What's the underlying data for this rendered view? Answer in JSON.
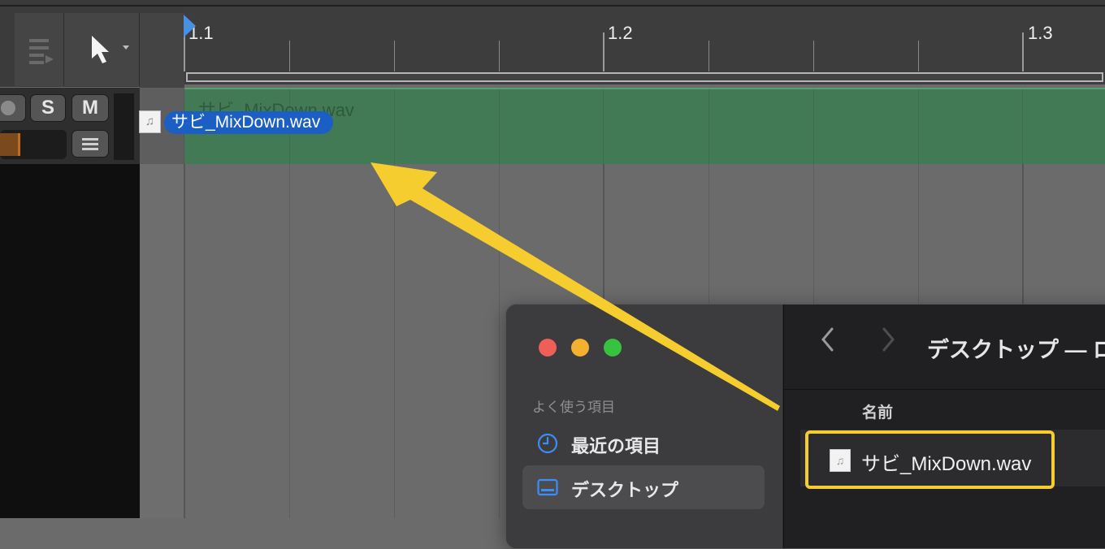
{
  "ruler": {
    "markers": [
      "1.1",
      "1.2",
      "1.3"
    ]
  },
  "track": {
    "solo_label": "S",
    "mute_label": "M",
    "region_name": "サビ_MixDown.wav"
  },
  "drag": {
    "filename": "サビ_MixDown.wav"
  },
  "finder": {
    "title": "デスクトップ — ロ",
    "sidebar_section": "よく使う項目",
    "sidebar_items": [
      {
        "label": "最近の項目",
        "icon": "clock-icon"
      },
      {
        "label": "デスクトップ",
        "icon": "desktop-icon",
        "selected": true
      }
    ],
    "column_name": "名前",
    "files": [
      {
        "name": "サビ_MixDown.wav",
        "icon": "audio-file-icon"
      }
    ],
    "traffic_colors": [
      "#ed5f57",
      "#f4b02f",
      "#37c23f"
    ]
  },
  "colors": {
    "region": "#427a55",
    "drag_label": "#1b5fc5",
    "arrow": "#f5cd2f",
    "playhead": "#4a90e2"
  }
}
